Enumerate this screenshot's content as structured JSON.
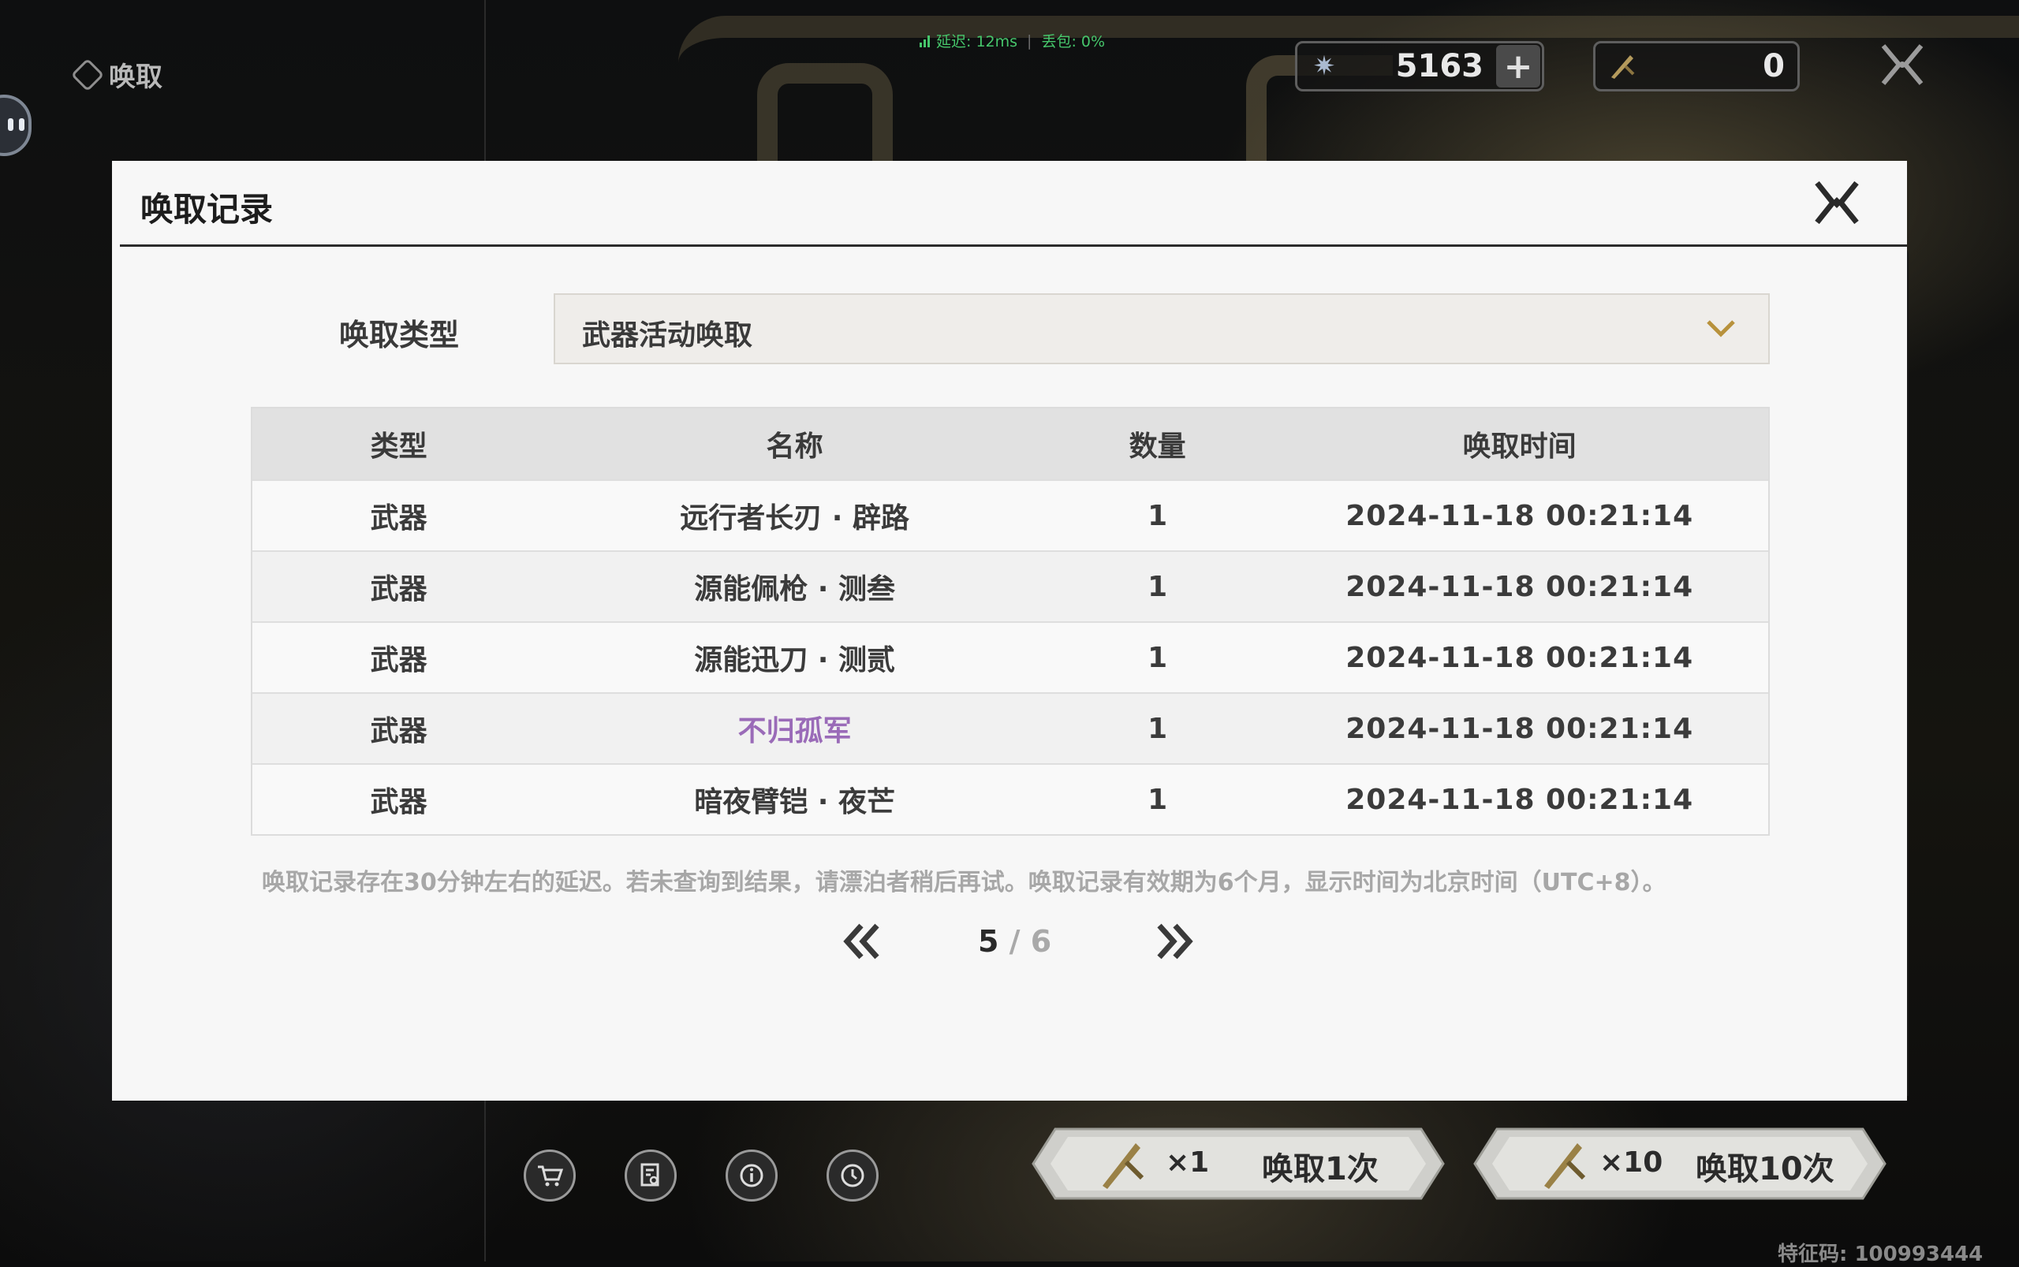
{
  "page": {
    "title": "唤取"
  },
  "network": {
    "latency": "延迟: 12ms",
    "loss": "丢包: 0%"
  },
  "currencies": [
    {
      "icon": "star-crystal-icon",
      "value": "5163",
      "add": "+"
    },
    {
      "icon": "forging-tide-icon",
      "value": "0"
    }
  ],
  "dialog": {
    "title": "唤取记录",
    "filter_label": "唤取类型",
    "filter_value": "武器活动唤取",
    "columns": [
      "类型",
      "名称",
      "数量",
      "唤取时间"
    ],
    "rows": [
      {
        "type": "武器",
        "name": "远行者长刃 · 辟路",
        "qty": "1",
        "time": "2024-11-18 00:21:14",
        "color": "#3b3b3b"
      },
      {
        "type": "武器",
        "name": "源能佩枪 · 测叁",
        "qty": "1",
        "time": "2024-11-18 00:21:14",
        "color": "#3b3b3b"
      },
      {
        "type": "武器",
        "name": "源能迅刀 · 测贰",
        "qty": "1",
        "time": "2024-11-18 00:21:14",
        "color": "#3b3b3b"
      },
      {
        "type": "武器",
        "name": "不归孤军",
        "qty": "1",
        "time": "2024-11-18 00:21:14",
        "color": "#9a6bb8"
      },
      {
        "type": "武器",
        "name": "暗夜臂铠 · 夜芒",
        "qty": "1",
        "time": "2024-11-18 00:21:14",
        "color": "#3b3b3b"
      }
    ],
    "note": "唤取记录存在30分钟左右的延迟。若未查询到结果，请漂泊者稍后再试。唤取记录有效期为6个月，显示时间为北京时间（UTC+8）。",
    "pagination": {
      "current": "5",
      "separator": " / ",
      "total": "6"
    }
  },
  "bottom": {
    "icons": [
      "cart-icon",
      "details-icon",
      "info-icon",
      "history-icon"
    ],
    "pull_once": {
      "mult": "×1",
      "label": "唤取1次"
    },
    "pull_ten": {
      "mult": "×10",
      "label": "唤取10次"
    },
    "feature_code": "特征码: 100993444"
  }
}
